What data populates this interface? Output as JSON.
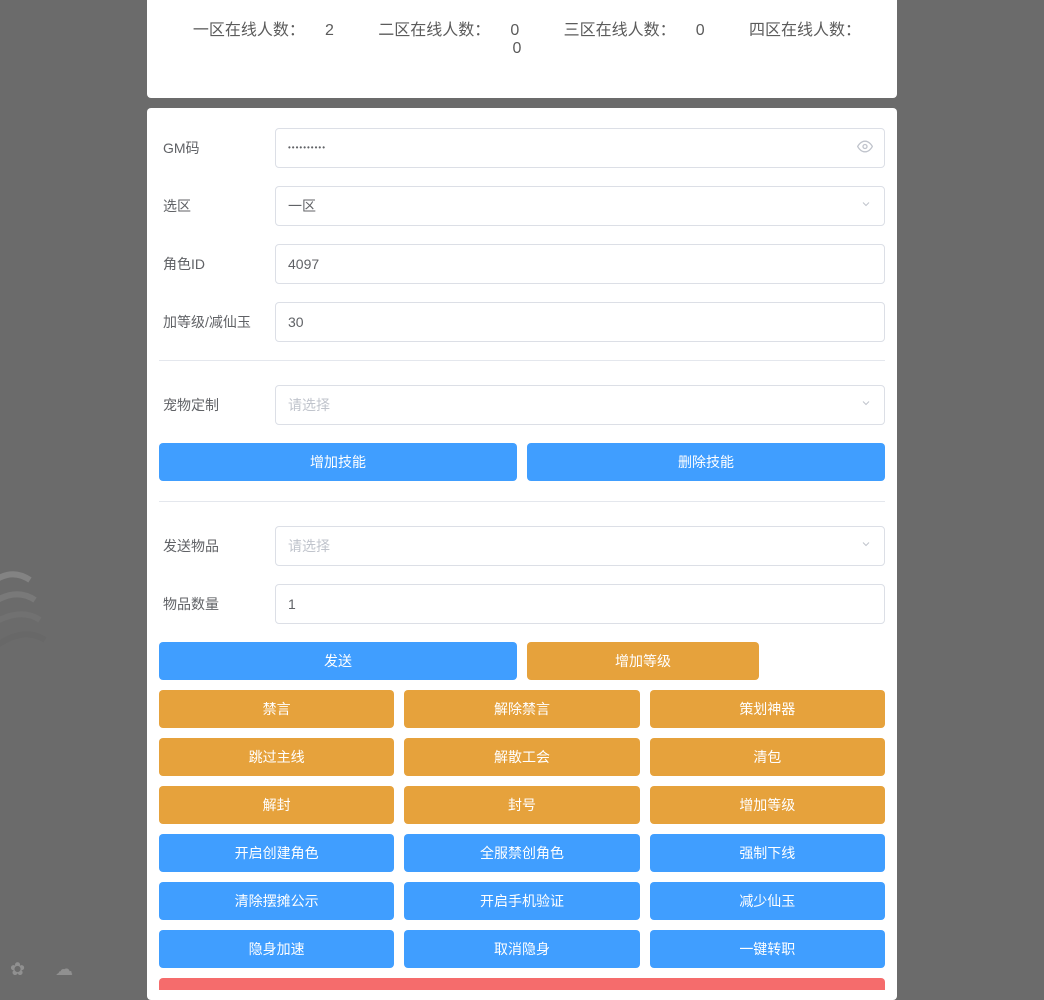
{
  "stats": [
    {
      "label": "一区在线人数：",
      "value": "2"
    },
    {
      "label": "二区在线人数：",
      "value": "0"
    },
    {
      "label": "三区在线人数：",
      "value": "0"
    },
    {
      "label": "四区在线人数：",
      "value": "0"
    }
  ],
  "form": {
    "gmcode_label": "GM码",
    "gmcode_value": "••••••••••",
    "zone_label": "选区",
    "zone_value": "一区",
    "roleid_label": "角色ID",
    "roleid_value": "4097",
    "level_label": "加等级/减仙玉",
    "level_value": "30",
    "pet_label": "宠物定制",
    "pet_placeholder": "请选择",
    "senditem_label": "发送物品",
    "senditem_placeholder": "请选择",
    "itemcount_label": "物品数量",
    "itemcount_value": "1"
  },
  "buttons": {
    "add_skill": "增加技能",
    "del_skill": "删除技能",
    "send": "发送",
    "add_level": "增加等级",
    "row_a": [
      "禁言",
      "解除禁言",
      "策划神器"
    ],
    "row_b": [
      "跳过主线",
      "解散工会",
      "清包"
    ],
    "row_c": [
      "解封",
      "封号",
      "增加等级"
    ],
    "row_d": [
      "开启创建角色",
      "全服禁创角色",
      "强制下线"
    ],
    "row_e": [
      "清除摆摊公示",
      "开启手机验证",
      "减少仙玉"
    ],
    "row_f": [
      "隐身加速",
      "取消隐身",
      "一键转职"
    ]
  }
}
